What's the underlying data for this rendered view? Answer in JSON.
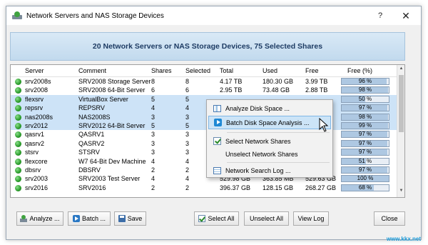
{
  "window": {
    "title": "Network Servers and NAS Storage Devices",
    "help_label": "?",
    "close_glyph": "✕"
  },
  "banner": {
    "text": "20 Network Servers or NAS Storage Devices, 75 Selected Shares"
  },
  "table": {
    "columns": [
      "Server",
      "Comment",
      "Shares",
      "Selected",
      "Total",
      "Used",
      "Free",
      "Free (%)"
    ],
    "rows": [
      {
        "server": "srv2008s",
        "comment": "SRV2008 Storage Server",
        "shares": "8",
        "selected": "8",
        "total": "4.17 TB",
        "used": "180.30 GB",
        "free": "3.99 TB",
        "free_pct": "96 %",
        "free_value": 96,
        "selected_row": false
      },
      {
        "server": "srv2008",
        "comment": "SRV2008 64-Bit Server",
        "shares": "6",
        "selected": "6",
        "total": "2.95 TB",
        "used": "73.48 GB",
        "free": "2.88 TB",
        "free_pct": "98 %",
        "free_value": 98,
        "selected_row": false
      },
      {
        "server": "flexsrv",
        "comment": "VirtualBox Server",
        "shares": "5",
        "selected": "5",
        "total": "",
        "used": "",
        "free": "",
        "free_pct": "50 %",
        "free_value": 50,
        "selected_row": true
      },
      {
        "server": "repsrv",
        "comment": "REPSRV",
        "shares": "4",
        "selected": "4",
        "total": "",
        "used": "",
        "free": "",
        "free_pct": "97 %",
        "free_value": 97,
        "selected_row": true
      },
      {
        "server": "nas2008s",
        "comment": "NAS2008S",
        "shares": "3",
        "selected": "3",
        "total": "",
        "used": "",
        "free": "",
        "free_pct": "98 %",
        "free_value": 98,
        "selected_row": true
      },
      {
        "server": "srv2012",
        "comment": "SRV2012 64-Bit Server",
        "shares": "5",
        "selected": "5",
        "total": "",
        "used": "",
        "free": "",
        "free_pct": "99 %",
        "free_value": 99,
        "selected_row": true
      },
      {
        "server": "qasrv1",
        "comment": "QASRV1",
        "shares": "3",
        "selected": "3",
        "total": "",
        "used": "",
        "free": "",
        "free_pct": "97 %",
        "free_value": 97,
        "selected_row": false
      },
      {
        "server": "qasrv2",
        "comment": "QASRV2",
        "shares": "3",
        "selected": "3",
        "total": "",
        "used": "",
        "free": "",
        "free_pct": "97 %",
        "free_value": 97,
        "selected_row": false
      },
      {
        "server": "stsrv",
        "comment": "STSRV",
        "shares": "3",
        "selected": "3",
        "total": "",
        "used": "",
        "free": "",
        "free_pct": "97 %",
        "free_value": 97,
        "selected_row": false
      },
      {
        "server": "flexcore",
        "comment": "W7 64-Bit Dev Machine",
        "shares": "4",
        "selected": "4",
        "total": "",
        "used": "",
        "free": "",
        "free_pct": "51 %",
        "free_value": 51,
        "selected_row": false
      },
      {
        "server": "dbsrv",
        "comment": "DBSRV",
        "shares": "2",
        "selected": "2",
        "total": "",
        "used": "",
        "free": "",
        "free_pct": "97 %",
        "free_value": 97,
        "selected_row": false
      },
      {
        "server": "srv2003",
        "comment": "SRV2003 Test Server",
        "shares": "4",
        "selected": "4",
        "total": "529.98 GB",
        "used": "363.85 MB",
        "free": "529.63 GB",
        "free_pct": "100 %",
        "free_value": 100,
        "selected_row": false
      },
      {
        "server": "srv2016",
        "comment": "SRV2016",
        "shares": "2",
        "selected": "2",
        "total": "396.37 GB",
        "used": "128.15 GB",
        "free": "268.27 GB",
        "free_pct": "68 %",
        "free_value": 68,
        "selected_row": false
      },
      {
        "server": "",
        "comment": "",
        "shares": "",
        "selected": "",
        "total": "",
        "used": "",
        "free": "",
        "free_pct": "",
        "free_value": 0,
        "selected_row": false
      }
    ]
  },
  "context_menu": {
    "items": [
      {
        "label": "Analyze Disk Space ...",
        "icon": "chart-icon",
        "highlighted": false
      },
      {
        "label": "Batch Disk Space Analysis ...",
        "icon": "play-icon",
        "highlighted": true
      },
      {
        "label": "Select Network Shares",
        "icon": "checkbox-icon",
        "highlighted": false
      },
      {
        "label": "Unselect Network Shares",
        "icon": "",
        "highlighted": false
      },
      {
        "label": "Network Search Log ...",
        "icon": "log-icon",
        "highlighted": false
      }
    ]
  },
  "buttons": {
    "analyze": "Analyze ...",
    "batch": "Batch ...",
    "save": "Save",
    "select_all": "Select All",
    "unselect_all": "Unselect All",
    "view_log": "View Log",
    "close": "Close"
  },
  "watermark": "www.kkx.net"
}
